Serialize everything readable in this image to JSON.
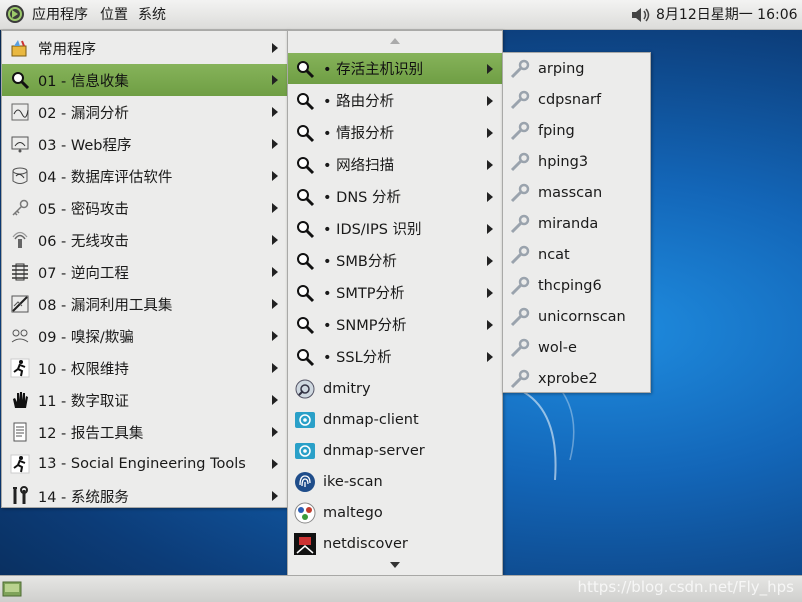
{
  "top_panel": {
    "apps_menu": "应用程序",
    "places_menu": "位置",
    "system_menu": "系统",
    "clock": "8月12日星期一 16:06"
  },
  "main_menu": {
    "items": [
      {
        "label": "常用程序",
        "icon": "favorites-icon"
      },
      {
        "label": "01 - 信息收集",
        "icon": "magnifier-icon"
      },
      {
        "label": "02 - 漏洞分析",
        "icon": "vuln-analysis-icon"
      },
      {
        "label": "03 - Web程序",
        "icon": "web-app-icon"
      },
      {
        "label": "04 - 数据库评估软件",
        "icon": "database-icon"
      },
      {
        "label": "05 - 密码攻击",
        "icon": "key-icon"
      },
      {
        "label": "06 - 无线攻击",
        "icon": "wireless-icon"
      },
      {
        "label": "07 - 逆向工程",
        "icon": "reverse-engineering-icon"
      },
      {
        "label": "08 - 漏洞利用工具集",
        "icon": "exploit-icon"
      },
      {
        "label": "09 - 嗅探/欺骗",
        "icon": "sniffing-icon"
      },
      {
        "label": "10 - 权限维持",
        "icon": "running-man-icon"
      },
      {
        "label": "11 - 数字取证",
        "icon": "hand-icon"
      },
      {
        "label": "12 - 报告工具集",
        "icon": "report-icon"
      },
      {
        "label": "13 - Social Engineering Tools",
        "icon": "social-engineering-icon"
      },
      {
        "label": "14 - 系统服务",
        "icon": "tools-icon"
      }
    ]
  },
  "sub_menu": {
    "items": [
      {
        "label": "• 存活主机识别",
        "icon": "magnifier-icon",
        "submenu": true
      },
      {
        "label": "• 路由分析",
        "icon": "magnifier-icon",
        "submenu": true
      },
      {
        "label": "• 情报分析",
        "icon": "magnifier-icon",
        "submenu": true
      },
      {
        "label": "• 网络扫描",
        "icon": "magnifier-icon",
        "submenu": true
      },
      {
        "label": "• DNS 分析",
        "icon": "magnifier-icon",
        "submenu": true
      },
      {
        "label": "• IDS/IPS 识别",
        "icon": "magnifier-icon",
        "submenu": true
      },
      {
        "label": "• SMB分析",
        "icon": "magnifier-icon",
        "submenu": true
      },
      {
        "label": "• SMTP分析",
        "icon": "magnifier-icon",
        "submenu": true
      },
      {
        "label": "• SNMP分析",
        "icon": "magnifier-icon",
        "submenu": true
      },
      {
        "label": "• SSL分析",
        "icon": "magnifier-icon",
        "submenu": true
      },
      {
        "label": "dmitry",
        "icon": "dmitry-icon",
        "submenu": false
      },
      {
        "label": "dnmap-client",
        "icon": "dnmap-icon",
        "submenu": false
      },
      {
        "label": "dnmap-server",
        "icon": "dnmap-icon",
        "submenu": false
      },
      {
        "label": "ike-scan",
        "icon": "fingerprint-icon",
        "submenu": false
      },
      {
        "label": "maltego",
        "icon": "maltego-icon",
        "submenu": false
      },
      {
        "label": "netdiscover",
        "icon": "netdiscover-icon",
        "submenu": false
      }
    ]
  },
  "tools_menu": {
    "items": [
      "arping",
      "cdpsnarf",
      "fping",
      "hping3",
      "masscan",
      "miranda",
      "ncat",
      "thcping6",
      "unicornscan",
      "wol-e",
      "xprobe2"
    ]
  },
  "colors": {
    "highlight": "#7aa84f",
    "menu_bg": "#ececeb",
    "desktop": "#1366b8"
  },
  "watermark": "https://blog.csdn.net/Fly_hps"
}
